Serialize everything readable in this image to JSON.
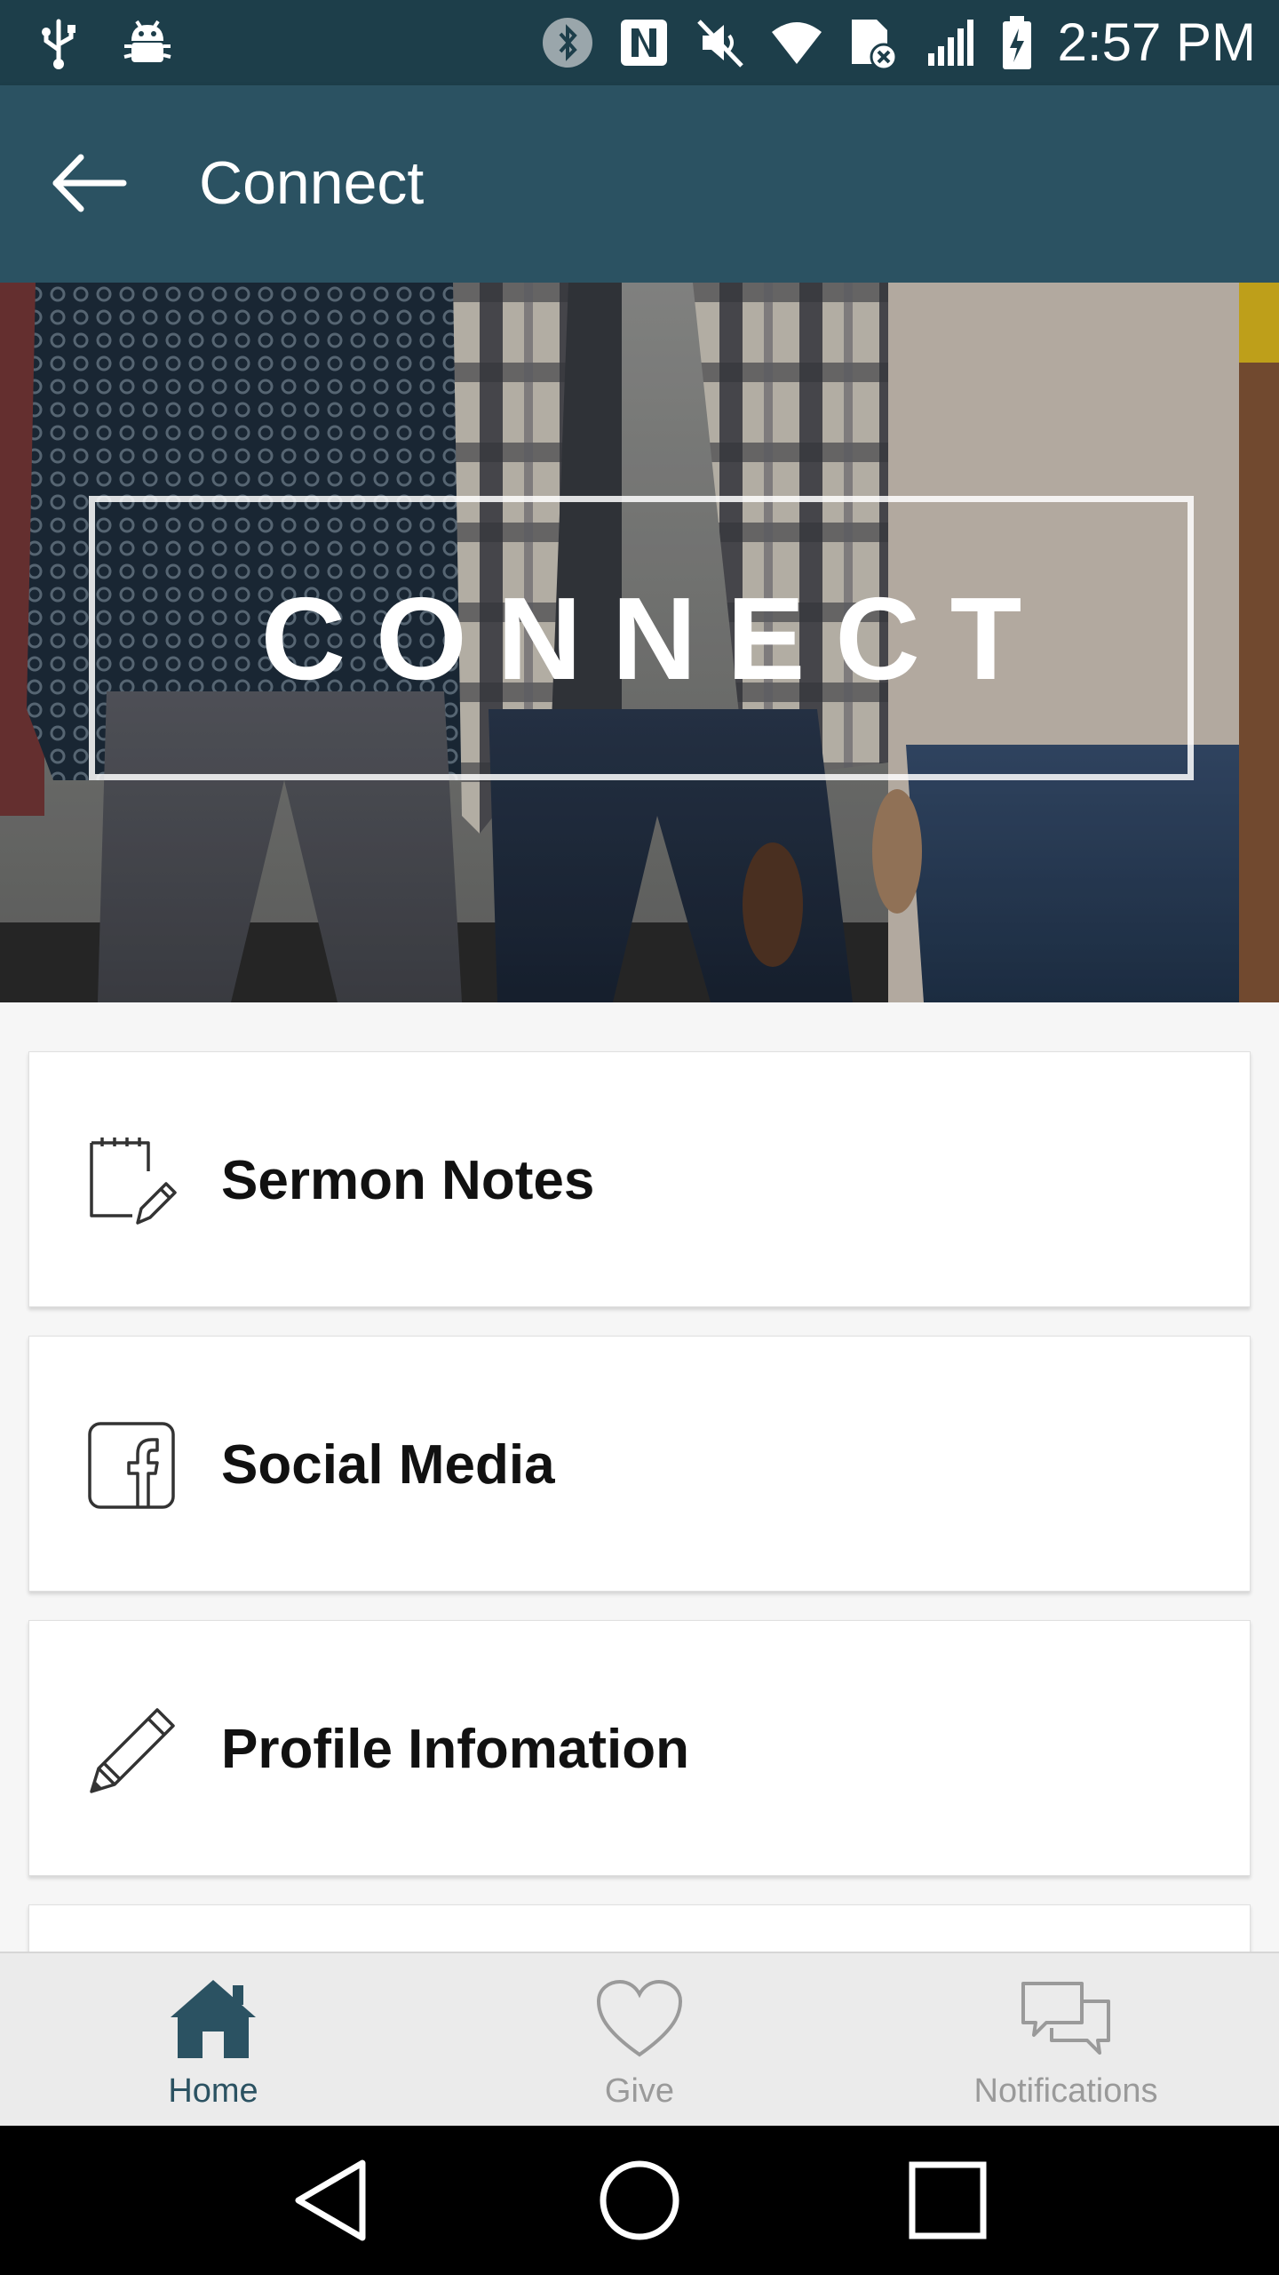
{
  "status_bar": {
    "time": "2:57 PM",
    "left_icons": [
      "usb-icon",
      "android-debug-icon"
    ],
    "right_icons": [
      "bluetooth-icon",
      "nfc-icon",
      "mute-icon",
      "wifi-icon",
      "sim-error-icon",
      "signal-icon",
      "battery-charging-icon"
    ]
  },
  "app_bar": {
    "title": "Connect",
    "back_icon": "arrow-back-icon"
  },
  "hero": {
    "title": "CONNECT"
  },
  "menu": {
    "items": [
      {
        "label": "Sermon Notes",
        "icon": "notepad-pencil-icon"
      },
      {
        "label": "Social Media",
        "icon": "facebook-icon"
      },
      {
        "label": "Profile Infomation",
        "icon": "pencil-icon"
      }
    ]
  },
  "tabs": [
    {
      "label": "Home",
      "icon": "home-icon",
      "active": true
    },
    {
      "label": "Give",
      "icon": "heart-icon",
      "active": false
    },
    {
      "label": "Notifications",
      "icon": "chat-bubbles-icon",
      "active": false
    }
  ],
  "nav_bar": {
    "buttons": [
      "back-triangle-icon",
      "home-circle-icon",
      "recents-square-icon"
    ]
  },
  "colors": {
    "status_bar": "#1d3e4a",
    "app_bar": "#2b5262",
    "accent": "#2b5262",
    "tab_inactive": "#9a9a9a",
    "background": "#f6f6f6"
  }
}
